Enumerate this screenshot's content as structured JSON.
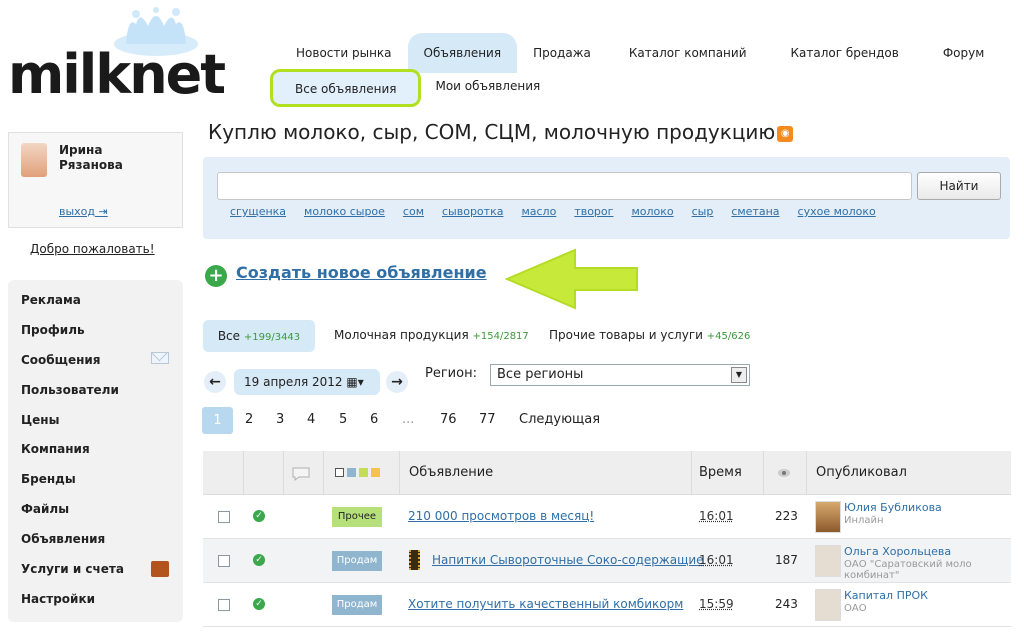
{
  "logo": {
    "text": "milknet"
  },
  "nav": {
    "tabs": [
      "Новости рынка",
      "Объявления",
      "Продажа",
      "Каталог компаний",
      "Каталог брендов",
      "Форум"
    ],
    "subtabs": [
      "Все объявления",
      "Мои объявления"
    ]
  },
  "user": {
    "name_line1": "Ирина",
    "name_line2": "Рязанова",
    "logout": "выход",
    "welcome": "Добро пожаловать!"
  },
  "sidebar": {
    "items": [
      "Реклама",
      "Профиль",
      "Сообщения",
      "Пользователи",
      "Цены",
      "Компания",
      "Бренды",
      "Файлы",
      "Объявления",
      "Услуги и счета",
      "Настройки"
    ]
  },
  "main": {
    "heading": "Куплю молоко, сыр, СОМ, СЦМ, молочную продукцию",
    "rss_glyph": "◉"
  },
  "search": {
    "value": "",
    "button": "Найти",
    "tags": [
      "сгущенка",
      "молоко сырое",
      "сом",
      "сыворотка",
      "масло",
      "творог",
      "молоко",
      "сыр",
      "сметана",
      "сухое молоко"
    ]
  },
  "create": {
    "plus": "+",
    "label": "Создать новое объявление"
  },
  "categories": [
    {
      "label": "Все",
      "count": "+199/3443"
    },
    {
      "label": "Молочная продукция",
      "count": "+154/2817"
    },
    {
      "label": "Прочие товары и услуги",
      "count": "+45/626"
    }
  ],
  "filter": {
    "prev": "←",
    "next": "→",
    "date": "19 апреля 2012",
    "calendar_glyph": "▦▾",
    "region_label": "Регион:",
    "region_value": "Все регионы",
    "region_dd": "▼"
  },
  "pagination": [
    "1",
    "2",
    "3",
    "4",
    "5",
    "6",
    "...",
    "76",
    "77",
    "Следующая"
  ],
  "table": {
    "headers": {
      "ad": "Объявление",
      "time": "Время",
      "published": "Опубликовал"
    },
    "rows": [
      {
        "badge": "Прочее",
        "title": "210 000 просмотров в месяц!",
        "time": "16:01",
        "views": "223",
        "author": "Юлия Бубликова",
        "sub": "Инлайн",
        "sub2": ""
      },
      {
        "badge": "Продам",
        "title": "Напитки Сывороточные Соко-содержащие",
        "time": "16:01",
        "views": "187",
        "author": "Ольга Хорольцева",
        "sub": "ОАО \"Саратовский моло",
        "sub2": "комбинат\""
      },
      {
        "badge": "Продам",
        "title": "Хотите получить качественный комбикорм",
        "time": "15:59",
        "views": "243",
        "author": "Капитал ПРОК",
        "sub": "ОАО",
        "sub2": ""
      }
    ]
  },
  "colors": {
    "accent_blue": "#d6e9f7",
    "link": "#2f6fa6",
    "highlight_green": "#b0e020",
    "ok_green": "#3aa84b"
  }
}
